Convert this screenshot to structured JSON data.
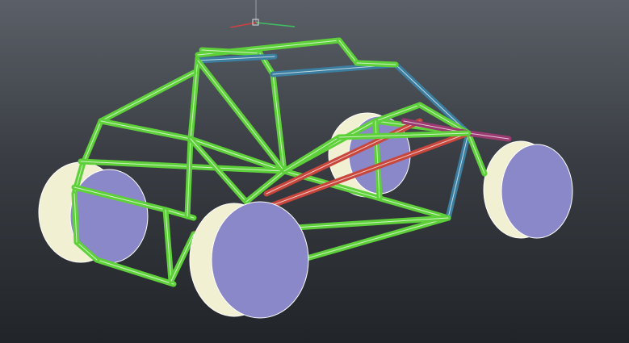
{
  "viewport": {
    "background_top": "#5b6068",
    "background_bottom": "#212428",
    "model": "tube-frame-buggy"
  },
  "colors": {
    "frame_green": "#5ed13a",
    "frame_blue": "#3b7ea0",
    "frame_red": "#c8463c",
    "frame_magenta": "#9a3a70",
    "tire": "#f2f0d2",
    "wheel_face": "#8a88c8"
  },
  "ucs_icon": "ucs-axis-icon"
}
